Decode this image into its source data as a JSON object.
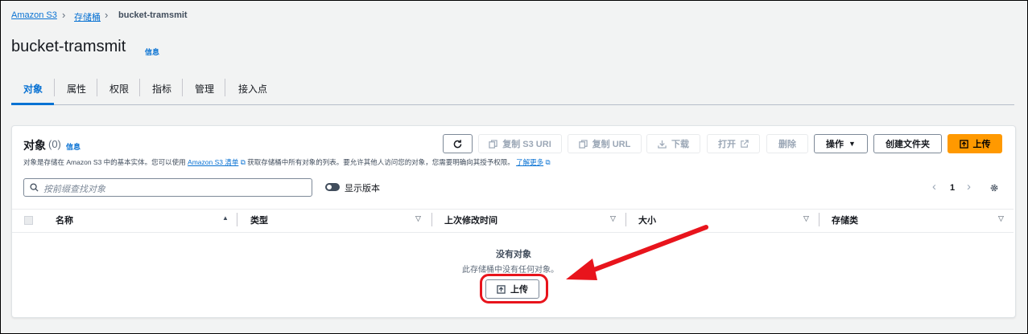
{
  "breadcrumb": {
    "items": [
      "Amazon S3",
      "存储桶",
      "bucket-tramsmit"
    ]
  },
  "page": {
    "title": "bucket-tramsmit",
    "info": "信息"
  },
  "tabs": [
    "对象",
    "属性",
    "权限",
    "指标",
    "管理",
    "接入点"
  ],
  "objects_panel": {
    "heading": "对象",
    "count": "(0)",
    "info": "信息",
    "desc_before": "对象是存储在 Amazon S3 中的基本实体。您可以使用",
    "desc_link1": "Amazon S3 清单",
    "desc_middle": "获取存储桶中所有对象的列表。要允许其他人访问您的对象，您需要明确向其授予权限。",
    "desc_link2": "了解更多",
    "buttons": {
      "copy_s3_uri": "复制 S3 URI",
      "copy_url": "复制 URL",
      "download": "下载",
      "open": "打开",
      "delete": "删除",
      "actions": "操作",
      "create_folder": "创建文件夹",
      "upload": "上传"
    },
    "search_placeholder": "按前缀查找对象",
    "show_versions": "显示版本",
    "page_number": "1",
    "columns": [
      "名称",
      "类型",
      "上次修改时间",
      "大小",
      "存储类"
    ],
    "empty_title": "没有对象",
    "empty_desc": "此存储桶中没有任何对象。",
    "empty_upload": "上传"
  },
  "colors": {
    "accent": "#0972d3",
    "primary_button": "#ff9900",
    "annotation": "#e8141c"
  }
}
